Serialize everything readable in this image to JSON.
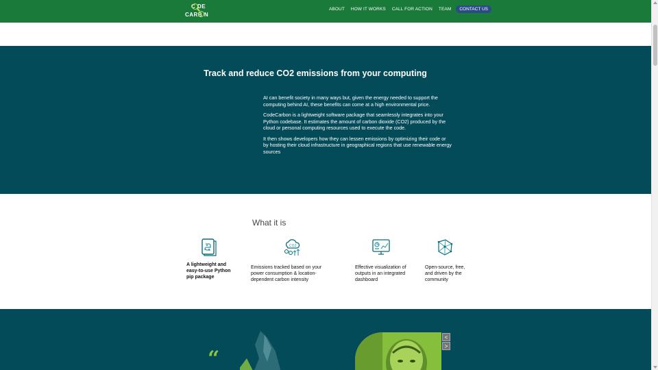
{
  "header": {
    "logo_line1": "C  DE",
    "logo_line2": "CARB N",
    "nav": [
      "ABOUT",
      "HOW IT WORKS",
      "CALL FOR ACTION",
      "TEAM"
    ],
    "contact_label": "CONTACT US"
  },
  "hero": {
    "title": "Track and reduce CO2 emissions from your computing",
    "paragraphs": [
      "AI can benefit society in many ways but, given the energy needed to support the computing behind AI, these benefits can come at a high environmental price.",
      "CodeCarbon is a lightweight software package that seamlessly integrates into your Python codebase. It estimates the amount of carbon dioxide (CO2) produced by the cloud or personal computing resources used to execute the code.",
      "It then shows developers how they can lessen emissions by optimizing their code or by hosting their cloud infrastructure in geographical regions that use renewable energy sources"
    ]
  },
  "what_it_is": {
    "title": "What it is",
    "features": [
      {
        "icon": "python-package-icon",
        "text": "A lightweight and easy-to-use Python pip package"
      },
      {
        "icon": "co2-emissions-icon",
        "text": "Emissions tracked based on your power consumption & location-dependent carbon intensity"
      },
      {
        "icon": "dashboard-icon",
        "text": "Effective visualization of outputs in an integrated dashboard"
      },
      {
        "icon": "community-network-icon",
        "text": "Open-source, free, and driven by the community"
      }
    ]
  },
  "testimonial": {
    "quote_mark": "“",
    "prev_label": "<",
    "next_label": ">"
  },
  "colors": {
    "header_green": "#1a7a3a",
    "teal": "#044b59",
    "accent_lime": "#8cc63f",
    "contact_blue": "#2b4b86"
  }
}
